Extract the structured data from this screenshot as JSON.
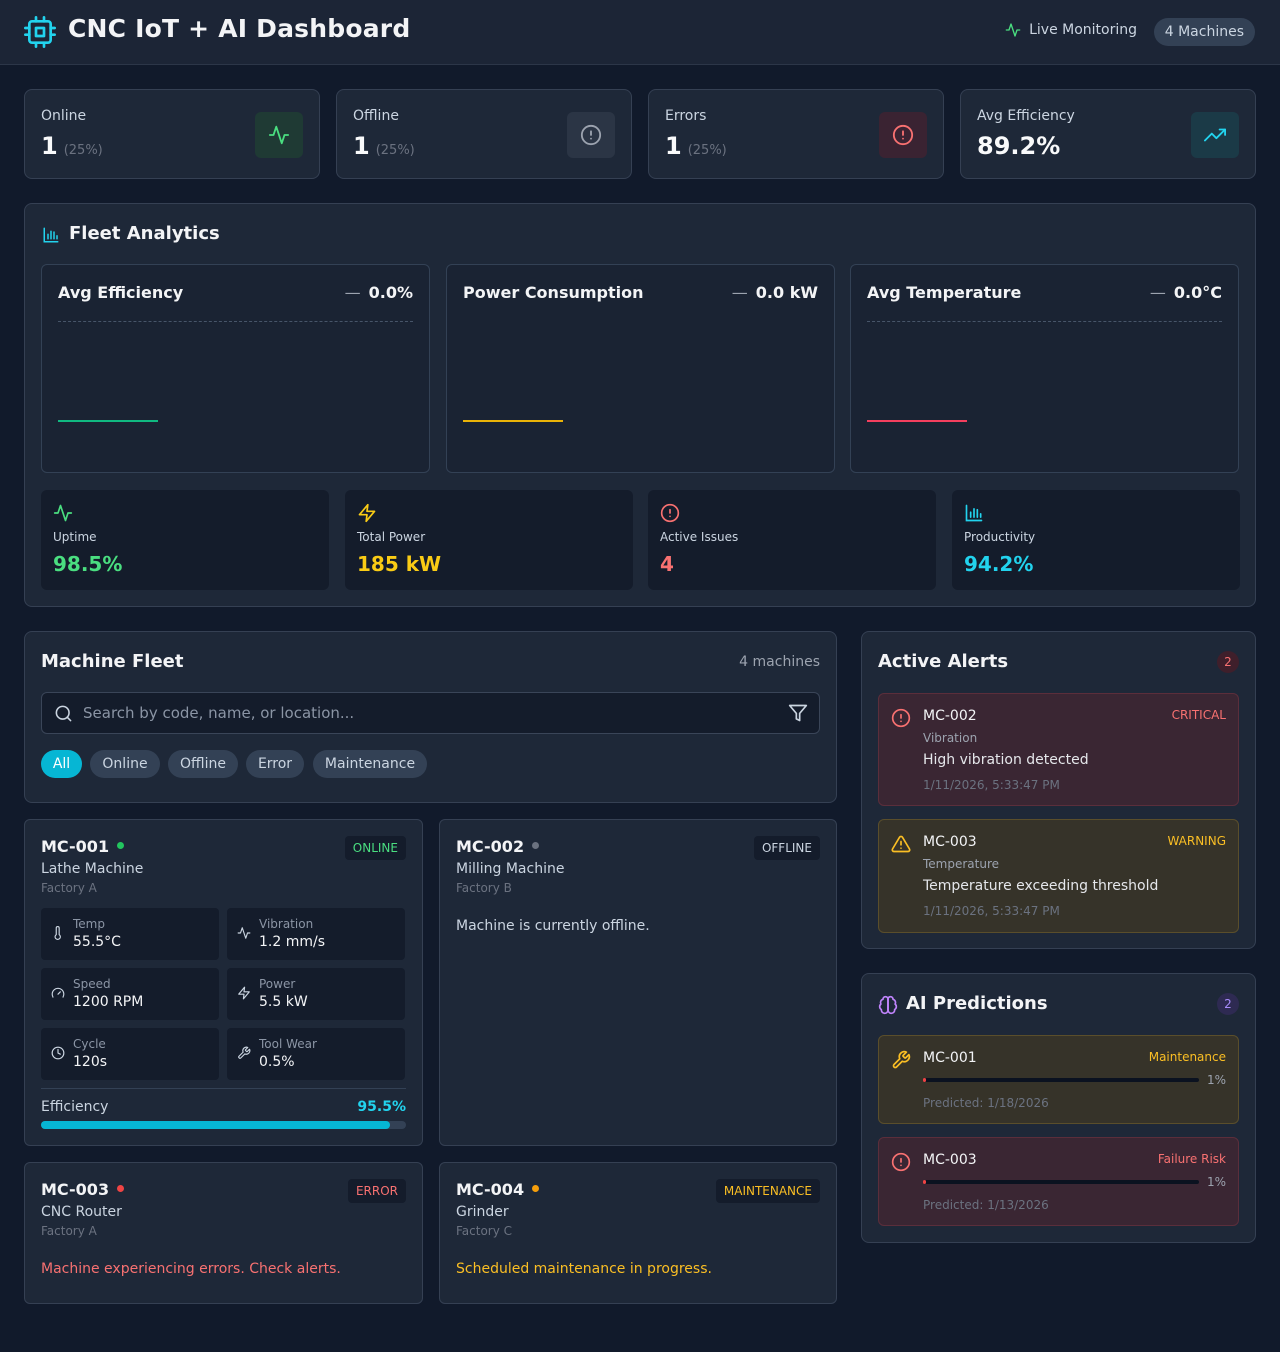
{
  "header": {
    "title": "CNC IoT + AI Dashboard",
    "live_label": "Live Monitoring",
    "machine_count": "4 Machines"
  },
  "stats": [
    {
      "label": "Online",
      "value": "1",
      "pct": "(25%)",
      "icon": "activity-icon",
      "color": "#4ade80"
    },
    {
      "label": "Offline",
      "value": "1",
      "pct": "(25%)",
      "icon": "alert-circle-icon",
      "color": "#9ca3af"
    },
    {
      "label": "Errors",
      "value": "1",
      "pct": "(25%)",
      "icon": "alert-circle-icon",
      "color": "#f87171"
    },
    {
      "label": "Avg Efficiency",
      "value": "89.2%",
      "pct": "",
      "icon": "trending-up-icon",
      "color": "#22d3ee"
    }
  ],
  "analytics": {
    "title": "Fleet Analytics",
    "charts": [
      {
        "title": "Avg Efficiency",
        "trend": "—",
        "value": "0.0%",
        "color": "#10b981"
      },
      {
        "title": "Power Consumption",
        "trend": "—",
        "value": "0.0 kW",
        "color": "#eab308"
      },
      {
        "title": "Avg Temperature",
        "trend": "—",
        "value": "0.0°C",
        "color": "#f43f5e"
      }
    ],
    "kpis": [
      {
        "label": "Uptime",
        "value": "98.5%",
        "icon": "activity-icon",
        "color": "#4ade80"
      },
      {
        "label": "Total Power",
        "value": "185 kW",
        "icon": "zap-icon",
        "color": "#facc15"
      },
      {
        "label": "Active Issues",
        "value": "4",
        "icon": "alert-circle-icon",
        "color": "#f87171"
      },
      {
        "label": "Productivity",
        "value": "94.2%",
        "icon": "bar-chart-icon",
        "color": "#22d3ee"
      }
    ]
  },
  "fleet": {
    "title": "Machine Fleet",
    "count": "4 machines",
    "search_placeholder": "Search by code, name, or location...",
    "filters": [
      "All",
      "Online",
      "Offline",
      "Error",
      "Maintenance"
    ],
    "active_filter": "All"
  },
  "machines": {
    "mc001": {
      "code": "MC-001",
      "name": "Lathe Machine",
      "location": "Factory A",
      "status": "ONLINE",
      "metrics": [
        {
          "label": "Temp",
          "value": "55.5°C",
          "icon": "thermometer-icon"
        },
        {
          "label": "Vibration",
          "value": "1.2 mm/s",
          "icon": "activity-icon"
        },
        {
          "label": "Speed",
          "value": "1200 RPM",
          "icon": "gauge-icon"
        },
        {
          "label": "Power",
          "value": "5.5 kW",
          "icon": "zap-icon"
        },
        {
          "label": "Cycle",
          "value": "120s",
          "icon": "clock-icon"
        },
        {
          "label": "Tool Wear",
          "value": "0.5%",
          "icon": "wrench-icon"
        }
      ],
      "efficiency_label": "Efficiency",
      "efficiency": "95.5%",
      "efficiency_fraction": 0.955
    },
    "mc002": {
      "code": "MC-002",
      "name": "Milling Machine",
      "location": "Factory B",
      "status": "OFFLINE",
      "message": "Machine is currently offline."
    },
    "mc003": {
      "code": "MC-003",
      "name": "CNC Router",
      "location": "Factory A",
      "status": "ERROR",
      "message": "Machine experiencing errors. Check alerts."
    },
    "mc004": {
      "code": "MC-004",
      "name": "Grinder",
      "location": "Factory C",
      "status": "MAINTENANCE",
      "message": "Scheduled maintenance in progress."
    }
  },
  "alerts": {
    "title": "Active Alerts",
    "count": "2",
    "items": [
      {
        "machine": "MC-002",
        "severity": "CRITICAL",
        "type": "Vibration",
        "description": "High vibration detected",
        "timestamp": "1/11/2026, 5:33:47 PM",
        "icon": "alert-circle-icon"
      },
      {
        "machine": "MC-003",
        "severity": "WARNING",
        "type": "Temperature",
        "description": "Temperature exceeding threshold",
        "timestamp": "1/11/2026, 5:33:47 PM",
        "icon": "warning-triangle-icon"
      }
    ]
  },
  "predictions": {
    "title": "AI Predictions",
    "count": "2",
    "items": [
      {
        "machine": "MC-001",
        "type": "Maintenance",
        "probability": "1%",
        "probability_fraction": 0.01,
        "date": "Predicted: 1/18/2026",
        "icon": "wrench-icon"
      },
      {
        "machine": "MC-003",
        "type": "Failure Risk",
        "probability": "1%",
        "probability_fraction": 0.01,
        "date": "Predicted: 1/13/2026",
        "icon": "alert-circle-icon"
      }
    ]
  },
  "colors": {
    "accent": "#06b6d4",
    "online": "#22c55e",
    "offline": "#6b7280",
    "error": "#ef4444",
    "maintenance": "#f59e0b"
  }
}
